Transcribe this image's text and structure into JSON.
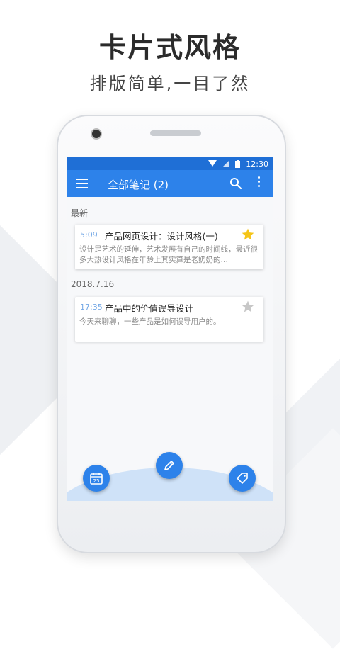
{
  "promo": {
    "headline": "卡片式风格",
    "subheadline": "排版简单,一目了然"
  },
  "status_bar": {
    "time": "12:30",
    "icons": [
      "wifi-icon",
      "signal-icon",
      "battery-icon"
    ]
  },
  "app_bar": {
    "title": "全部笔记 (2)",
    "icons": [
      "menu-icon",
      "search-icon",
      "more-vert-icon"
    ]
  },
  "sections": [
    {
      "label": "最新",
      "notes": [
        {
          "time": "5:09",
          "title": "产品网页设计：设计风格(一)",
          "preview": "设计是艺术的延伸，艺术发展有自己的时间线，最近很多大热设计风格在年龄上其实算是老奶奶的…",
          "starred": true
        }
      ]
    },
    {
      "label": "2018.7.16",
      "notes": [
        {
          "time": "17:35",
          "title": "产品中的价值误导设计",
          "preview": "今天来聊聊，一些产品是如何误导用户的。",
          "starred": false
        }
      ]
    }
  ],
  "bottom_actions": [
    {
      "name": "calendar-button",
      "icon": "calendar-icon",
      "label": "25"
    },
    {
      "name": "new-note-button",
      "icon": "pencil-icon"
    },
    {
      "name": "tags-button",
      "icon": "tag-icon"
    }
  ],
  "colors": {
    "accent": "#2d82ea",
    "status_bar": "#1f6fd6",
    "star_active": "#f5c518",
    "star_inactive": "#c7c7c7"
  }
}
